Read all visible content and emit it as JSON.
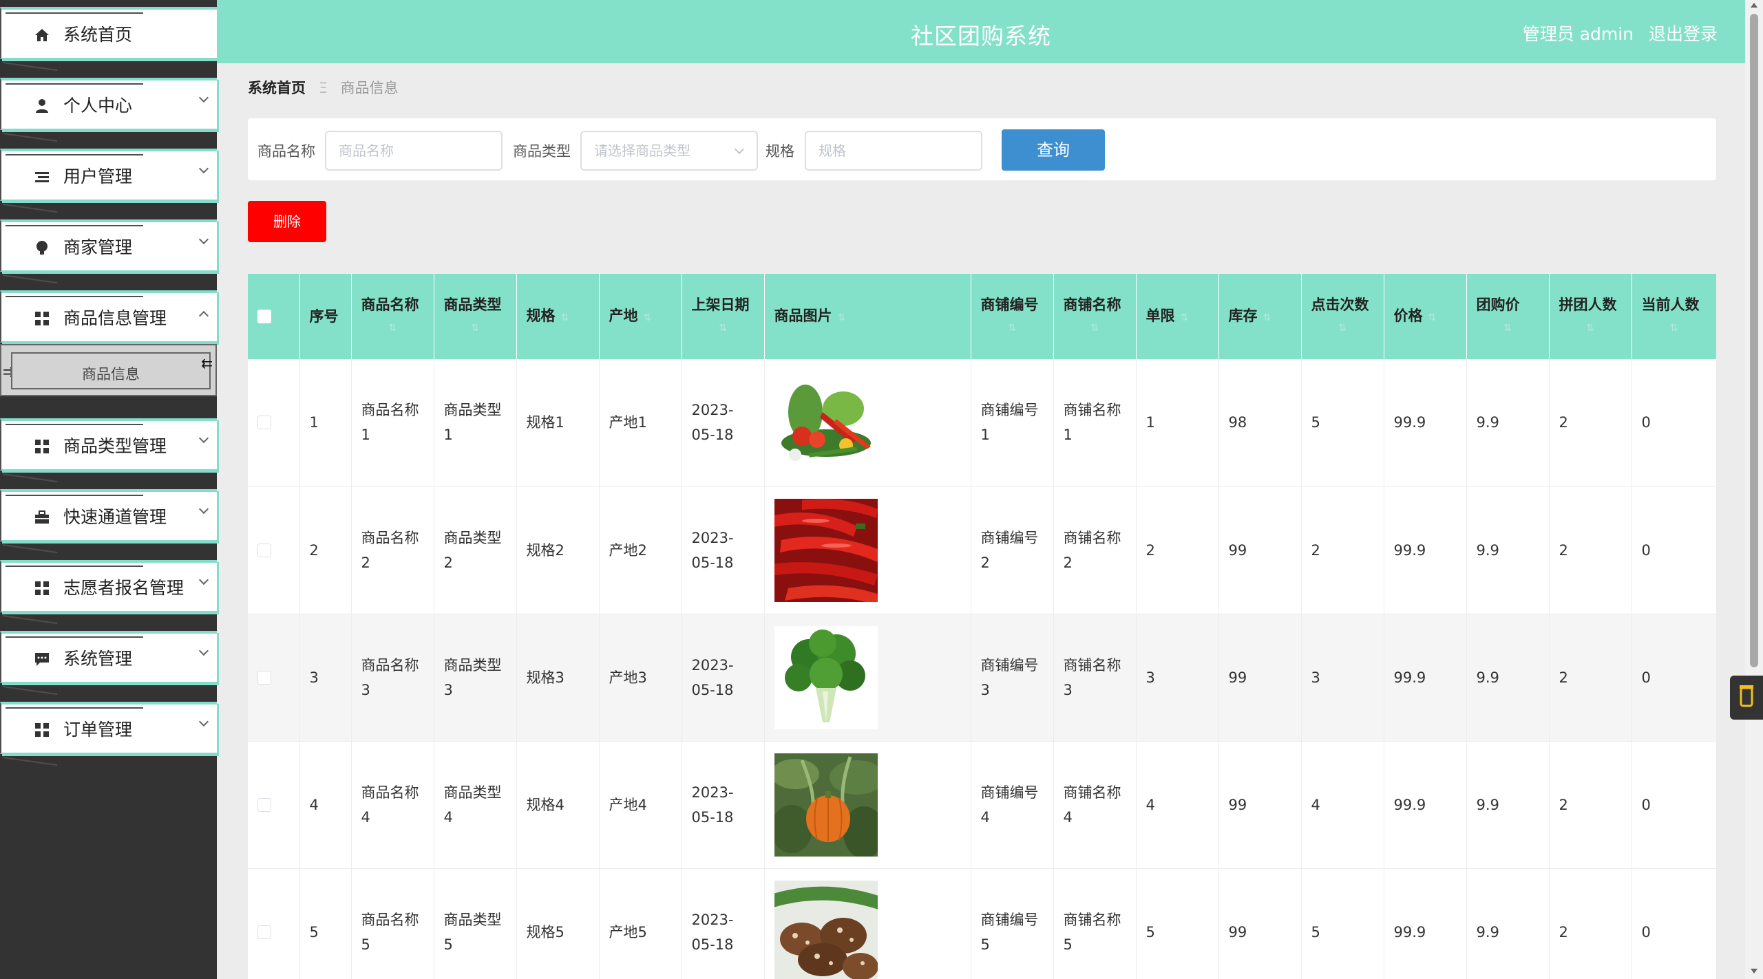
{
  "header": {
    "title": "社区团购系统",
    "user": "管理员 admin",
    "logout": "退出登录"
  },
  "sidebar": {
    "items": [
      {
        "label": "系统首页",
        "icon": "home-icon"
      },
      {
        "label": "个人中心",
        "icon": "user-icon"
      },
      {
        "label": "用户管理",
        "icon": "list-icon"
      },
      {
        "label": "商家管理",
        "icon": "bulb-icon"
      },
      {
        "label": "商品信息管理",
        "icon": "grid-icon"
      },
      {
        "label": "商品类型管理",
        "icon": "grid-icon"
      },
      {
        "label": "快速通道管理",
        "icon": "briefcase-icon"
      },
      {
        "label": "志愿者报名管理",
        "icon": "grid-icon"
      },
      {
        "label": "系统管理",
        "icon": "chat-icon"
      },
      {
        "label": "订单管理",
        "icon": "grid-icon"
      }
    ],
    "submenu": {
      "label": "商品信息"
    }
  },
  "breadcrumb": {
    "home": "系统首页",
    "separator": "Ξ",
    "current": "商品信息"
  },
  "search": {
    "name_label": "商品名称",
    "name_placeholder": "商品名称",
    "type_label": "商品类型",
    "type_placeholder": "请选择商品类型",
    "spec_label": "规格",
    "spec_placeholder": "规格",
    "query_button": "查询"
  },
  "actions": {
    "delete_button": "删除"
  },
  "table": {
    "columns": [
      "序号",
      "商品名称",
      "商品类型",
      "规格",
      "产地",
      "上架日期",
      "商品图片",
      "商铺编号",
      "商铺名称",
      "单限",
      "库存",
      "点击次数",
      "价格",
      "团购价",
      "拼团人数",
      "当前人数"
    ],
    "sort_glyph": "⇅",
    "rows": [
      {
        "no": "1",
        "name": "商品名称1",
        "type": "商品类型1",
        "spec": "规格1",
        "origin": "产地1",
        "date": "2023-05-18",
        "image": "vegetables-assortment",
        "shop_no": "商铺编号1",
        "shop_name": "商铺名称1",
        "limit": "1",
        "stock": "98",
        "clicks": "5",
        "price": "99.9",
        "group_price": "9.9",
        "group_size": "2",
        "current": "0"
      },
      {
        "no": "2",
        "name": "商品名称2",
        "type": "商品类型2",
        "spec": "规格2",
        "origin": "产地2",
        "date": "2023-05-18",
        "image": "red-peppers",
        "shop_no": "商铺编号2",
        "shop_name": "商铺名称2",
        "limit": "2",
        "stock": "99",
        "clicks": "2",
        "price": "99.9",
        "group_price": "9.9",
        "group_size": "2",
        "current": "0"
      },
      {
        "no": "3",
        "name": "商品名称3",
        "type": "商品类型3",
        "spec": "规格3",
        "origin": "产地3",
        "date": "2023-05-18",
        "image": "leafy-greens",
        "shop_no": "商铺编号3",
        "shop_name": "商铺名称3",
        "limit": "3",
        "stock": "99",
        "clicks": "3",
        "price": "99.9",
        "group_price": "9.9",
        "group_size": "2",
        "current": "0"
      },
      {
        "no": "4",
        "name": "商品名称4",
        "type": "商品类型4",
        "spec": "规格4",
        "origin": "产地4",
        "date": "2023-05-18",
        "image": "pumpkin",
        "shop_no": "商铺编号4",
        "shop_name": "商铺名称4",
        "limit": "4",
        "stock": "99",
        "clicks": "4",
        "price": "99.9",
        "group_price": "9.9",
        "group_size": "2",
        "current": "0"
      },
      {
        "no": "5",
        "name": "商品名称5",
        "type": "商品类型5",
        "spec": "规格5",
        "origin": "产地5",
        "date": "2023-05-18",
        "image": "shiitake-mushrooms",
        "shop_no": "商铺编号5",
        "shop_name": "商铺名称5",
        "limit": "5",
        "stock": "99",
        "clicks": "5",
        "price": "99.9",
        "group_price": "9.9",
        "group_size": "2",
        "current": "0"
      }
    ]
  },
  "colors": {
    "accent": "#84e1c9",
    "sidebar_bg": "#333333",
    "query_button": "#3d8fd0",
    "delete_button": "#ff0000"
  }
}
